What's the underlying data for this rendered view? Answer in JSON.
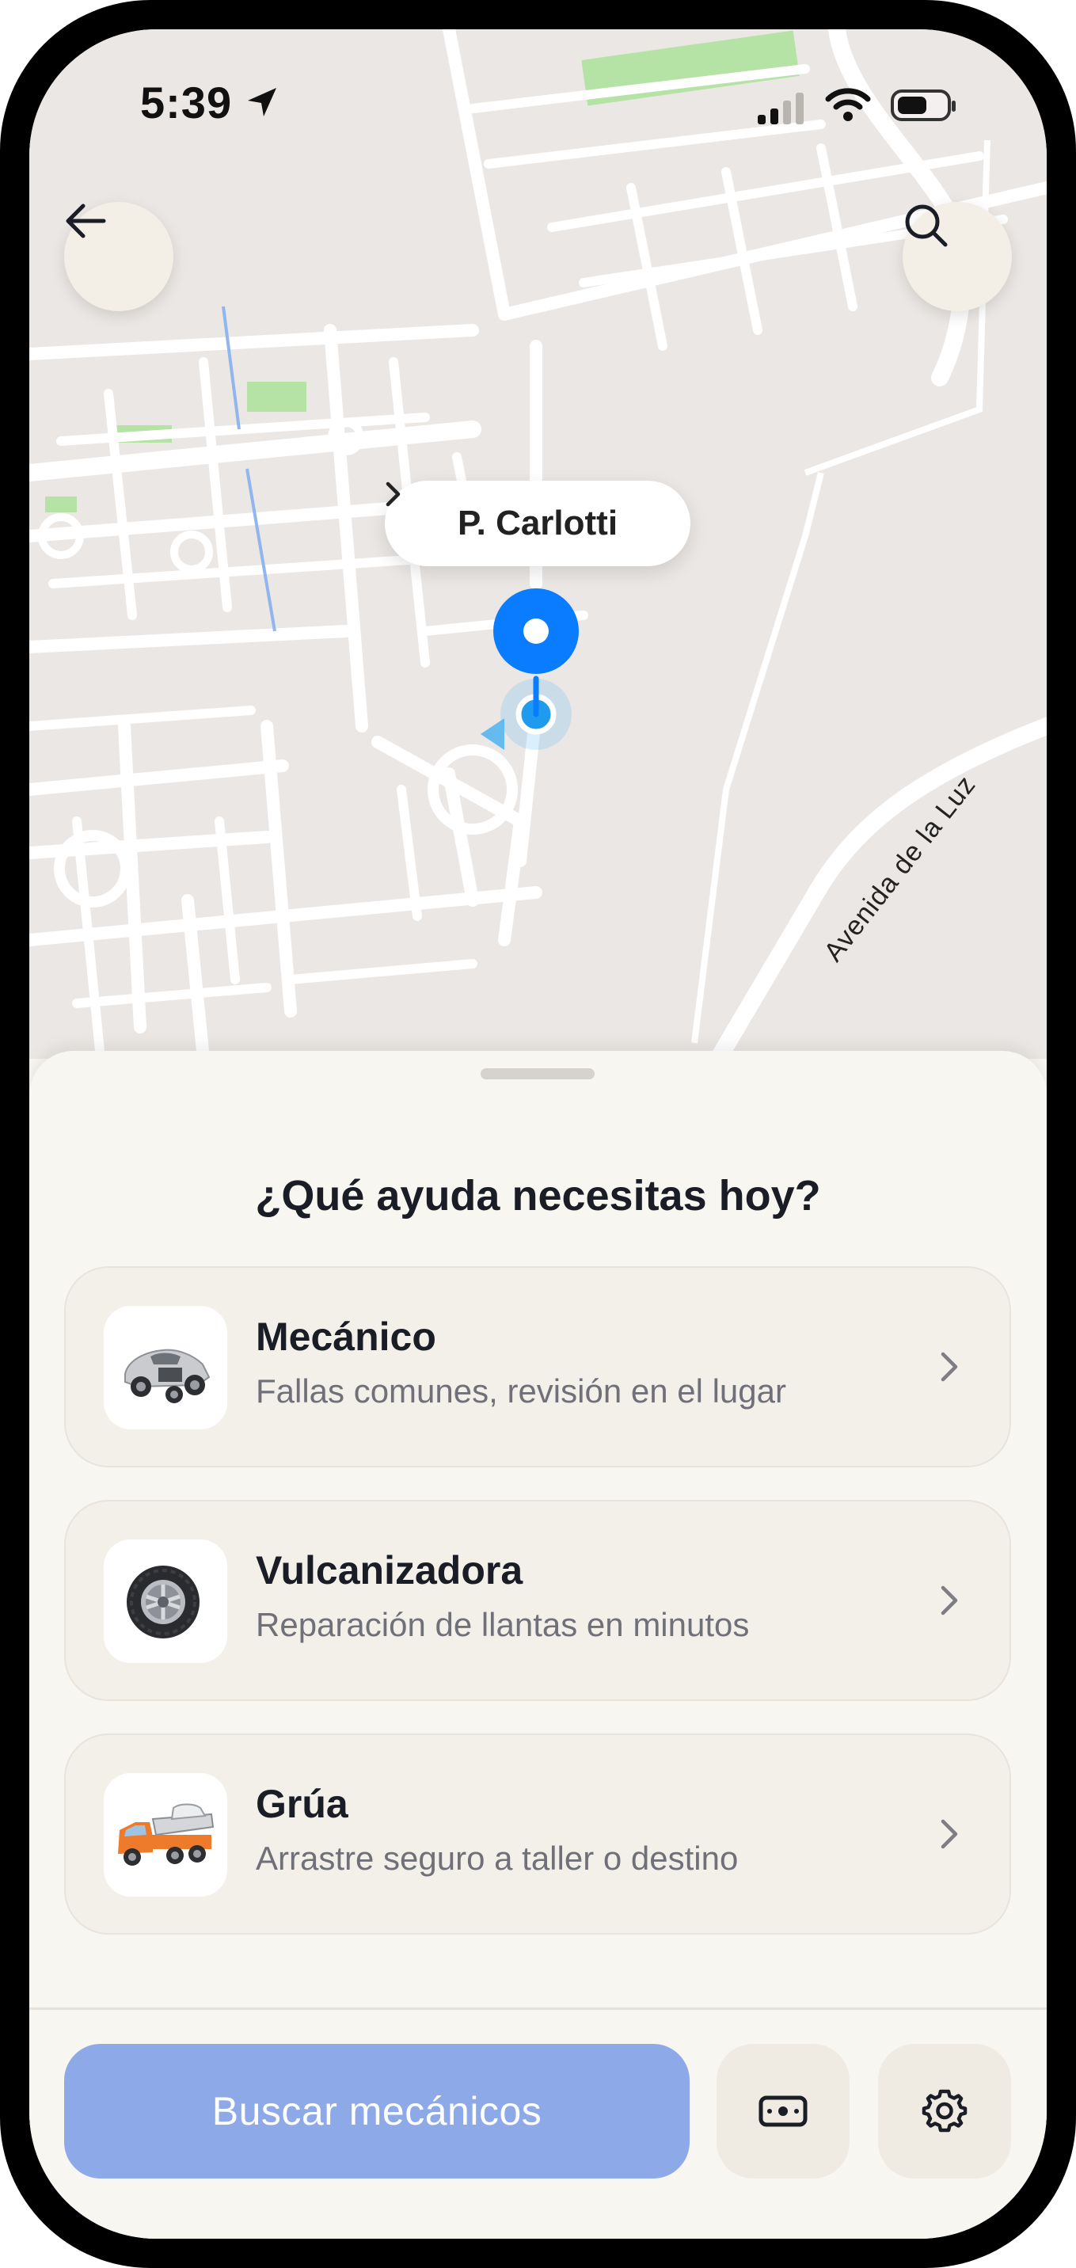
{
  "status_bar": {
    "time": "5:39"
  },
  "map": {
    "place_pill": "P. Carlotti",
    "street_label": "Avenida de la Luz"
  },
  "sheet": {
    "title": "¿Qué ayuda necesitas hoy?",
    "options": [
      {
        "title": "Mecánico",
        "subtitle": "Fallas comunes, revisión en el lugar",
        "icon": "car-chassis-icon"
      },
      {
        "title": "Vulcanizadora",
        "subtitle": "Reparación de llantas en minutos",
        "icon": "tire-icon"
      },
      {
        "title": "Grúa",
        "subtitle": "Arrastre seguro a taller o destino",
        "icon": "tow-truck-icon"
      }
    ]
  },
  "footer": {
    "search_label": "Buscar mecánicos"
  },
  "colors": {
    "accent": "#8ea9e8",
    "pin": "#0a7cff",
    "background": "#f8f6f1"
  }
}
